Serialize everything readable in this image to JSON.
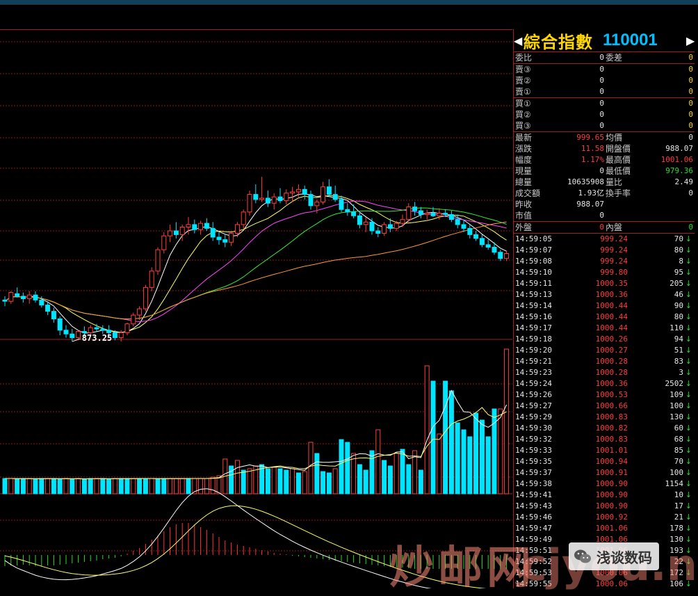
{
  "header": {
    "name": "綜合指數",
    "code": "110001"
  },
  "orders": {
    "top": [
      {
        "l1": "委比",
        "v1": "0",
        "l2": "委差",
        "v2": "0"
      }
    ],
    "sell": [
      {
        "label": "賣③",
        "price": "0",
        "vol": "0"
      },
      {
        "label": "賣②",
        "price": "0",
        "vol": "0"
      },
      {
        "label": "賣①",
        "price": "0",
        "vol": "0"
      }
    ],
    "buy": [
      {
        "label": "買①",
        "price": "0",
        "vol": "0"
      },
      {
        "label": "買②",
        "price": "0",
        "vol": "0"
      },
      {
        "label": "買③",
        "price": "0",
        "vol": "0"
      }
    ]
  },
  "stats": [
    {
      "l1": "最新",
      "v1": "999.65",
      "c1": "red",
      "l2": "均價",
      "v2": "0",
      "c2": "white"
    },
    {
      "l1": "漲跌",
      "v1": "11.58",
      "c1": "red",
      "l2": "開盤價",
      "v2": "988.07",
      "c2": "white"
    },
    {
      "l1": "幅度",
      "v1": "1.17%",
      "c1": "red",
      "l2": "最高價",
      "v2": "1001.06",
      "c2": "red"
    },
    {
      "l1": "現量",
      "v1": "0",
      "c1": "white",
      "l2": "最低價",
      "v2": "979.36",
      "c2": "green"
    },
    {
      "l1": "總量",
      "v1": "10635908",
      "c1": "white",
      "l2": "量比",
      "v2": "2.49",
      "c2": "white"
    },
    {
      "l1": "成交額",
      "v1": "1.93亿",
      "c1": "white",
      "l2": "換手率",
      "v2": "0",
      "c2": "white"
    },
    {
      "l1": "昨收",
      "v1": "988.07",
      "c1": "white",
      "l2": "",
      "v2": "",
      "c2": "white"
    },
    {
      "l1": "市值",
      "v1": "0",
      "c1": "white",
      "l2": "",
      "v2": "",
      "c2": "white"
    }
  ],
  "outer_inner": {
    "l1": "外盤",
    "v1": "0",
    "l2": "內盤",
    "v2": "0"
  },
  "trades": [
    {
      "time": "14:59:05",
      "price": "999.24",
      "vol": "70"
    },
    {
      "time": "14:59:07",
      "price": "999.24",
      "vol": "80"
    },
    {
      "time": "14:59:08",
      "price": "999.24",
      "vol": "8"
    },
    {
      "time": "14:59:10",
      "price": "999.80",
      "vol": "95"
    },
    {
      "time": "14:59:11",
      "price": "1000.35",
      "vol": "205"
    },
    {
      "time": "14:59:13",
      "price": "1000.36",
      "vol": "46"
    },
    {
      "time": "14:59:14",
      "price": "1000.44",
      "vol": "90"
    },
    {
      "time": "14:59:16",
      "price": "1000.44",
      "vol": "80"
    },
    {
      "time": "14:59:17",
      "price": "1000.44",
      "vol": "110"
    },
    {
      "time": "14:59:18",
      "price": "1000.26",
      "vol": "94"
    },
    {
      "time": "14:59:20",
      "price": "1000.27",
      "vol": "51"
    },
    {
      "time": "14:59:21",
      "price": "1000.28",
      "vol": "83"
    },
    {
      "time": "14:59:23",
      "price": "1000.28",
      "vol": "3"
    },
    {
      "time": "14:59:24",
      "price": "1000.36",
      "vol": "2502"
    },
    {
      "time": "14:59:26",
      "price": "1000.53",
      "vol": "109"
    },
    {
      "time": "14:59:27",
      "price": "1000.66",
      "vol": "100"
    },
    {
      "time": "14:59:29",
      "price": "1000.83",
      "vol": "130"
    },
    {
      "time": "14:59:30",
      "price": "1000.82",
      "vol": "60"
    },
    {
      "time": "14:59:32",
      "price": "1000.83",
      "vol": "68"
    },
    {
      "time": "14:59:33",
      "price": "1001.01",
      "vol": "85"
    },
    {
      "time": "14:59:35",
      "price": "1000.94",
      "vol": "70"
    },
    {
      "time": "14:59:37",
      "price": "1000.91",
      "vol": "100"
    },
    {
      "time": "14:59:38",
      "price": "1000.90",
      "vol": "1154"
    },
    {
      "time": "14:59:41",
      "price": "1000.90",
      "vol": "10"
    },
    {
      "time": "14:59:43",
      "price": "1000.90",
      "vol": "17"
    },
    {
      "time": "14:59:46",
      "price": "1000.92",
      "vol": "21"
    },
    {
      "time": "14:59:47",
      "price": "1001.06",
      "vol": "178"
    },
    {
      "time": "14:59:49",
      "price": "1001.06",
      "vol": "130"
    },
    {
      "time": "14:59:51",
      "price": "1001.06",
      "vol": "193"
    },
    {
      "time": "14:59:52",
      "price": "1001.06",
      "vol": "22"
    },
    {
      "time": "14:59:53",
      "price": "1000.06",
      "vol": "172"
    },
    {
      "time": "14:59:55",
      "price": "1000.06",
      "vol": "106"
    }
  ],
  "watermark": {
    "text": "炒邮网",
    "domain": "cjyou.net",
    "badge": "浅谈数码"
  },
  "colors": {
    "up": "#ff4040",
    "down": "#00e5ff",
    "grid": "#8b1a1a",
    "ma5": "#ffffff",
    "ma10": "#ffff66",
    "ma20": "#ff44ff",
    "ma30": "#33ee33",
    "ma60": "#ff9933"
  },
  "chart_data": {
    "type": "candlestick",
    "min_label": "873.25",
    "ohlc": [
      [
        898,
        901,
        893,
        897
      ],
      [
        897,
        905,
        895,
        904
      ],
      [
        903,
        908,
        900,
        901
      ],
      [
        901,
        904,
        896,
        899
      ],
      [
        899,
        905,
        895,
        902
      ],
      [
        902,
        905,
        896,
        898
      ],
      [
        898,
        901,
        892,
        894
      ],
      [
        894,
        897,
        886,
        889
      ],
      [
        889,
        892,
        880,
        883
      ],
      [
        883,
        885,
        870,
        874
      ],
      [
        874,
        878,
        868,
        871
      ],
      [
        871,
        875,
        865,
        868
      ],
      [
        868,
        874,
        866,
        873
      ],
      [
        873,
        877,
        869,
        872
      ],
      [
        872,
        878,
        870,
        876
      ],
      [
        876,
        879,
        873,
        875
      ],
      [
        875,
        878,
        871,
        874
      ],
      [
        874,
        878,
        870,
        872
      ],
      [
        872,
        874,
        866,
        868
      ],
      [
        868,
        874,
        865,
        872
      ],
      [
        872,
        880,
        870,
        879
      ],
      [
        879,
        888,
        877,
        886
      ],
      [
        886,
        893,
        882,
        891
      ],
      [
        891,
        910,
        889,
        908
      ],
      [
        908,
        924,
        905,
        921
      ],
      [
        921,
        940,
        918,
        938
      ],
      [
        938,
        952,
        935,
        949
      ],
      [
        949,
        958,
        944,
        953
      ],
      [
        953,
        960,
        947,
        950
      ],
      [
        950,
        958,
        945,
        956
      ],
      [
        956,
        964,
        950,
        958
      ],
      [
        958,
        962,
        951,
        954
      ],
      [
        954,
        961,
        950,
        959
      ],
      [
        959,
        963,
        953,
        955
      ],
      [
        955,
        960,
        945,
        948
      ],
      [
        948,
        952,
        942,
        946
      ],
      [
        946,
        950,
        940,
        944
      ],
      [
        944,
        953,
        941,
        951
      ],
      [
        951,
        960,
        948,
        958
      ],
      [
        958,
        970,
        954,
        968
      ],
      [
        968,
        985,
        965,
        982
      ],
      [
        982,
        990,
        975,
        978
      ],
      [
        978,
        996,
        976,
        979
      ],
      [
        979,
        985,
        972,
        975
      ],
      [
        975,
        983,
        970,
        980
      ],
      [
        980,
        987,
        975,
        977
      ],
      [
        977,
        986,
        974,
        983
      ],
      [
        983,
        988,
        976,
        984
      ],
      [
        984,
        990,
        980,
        986
      ],
      [
        986,
        989,
        978,
        982
      ],
      [
        982,
        985,
        970,
        973
      ],
      [
        973,
        978,
        967,
        976
      ],
      [
        976,
        992,
        974,
        988
      ],
      [
        988,
        994,
        980,
        982
      ],
      [
        982,
        989,
        976,
        978
      ],
      [
        978,
        981,
        968,
        970
      ],
      [
        970,
        975,
        965,
        968
      ],
      [
        968,
        974,
        963,
        965
      ],
      [
        965,
        968,
        955,
        958
      ],
      [
        958,
        964,
        952,
        960
      ],
      [
        960,
        963,
        950,
        953
      ],
      [
        953,
        956,
        948,
        951
      ],
      [
        951,
        960,
        949,
        958
      ],
      [
        958,
        963,
        952,
        955
      ],
      [
        955,
        961,
        953,
        959
      ],
      [
        959,
        966,
        956,
        962
      ],
      [
        962,
        975,
        960,
        972
      ],
      [
        972,
        976,
        965,
        969
      ],
      [
        969,
        972,
        963,
        966
      ],
      [
        966,
        970,
        962,
        967
      ],
      [
        967,
        972,
        964,
        965
      ],
      [
        965,
        971,
        962,
        967
      ],
      [
        967,
        970,
        964,
        966
      ],
      [
        966,
        969,
        960,
        962
      ],
      [
        962,
        966,
        955,
        958
      ],
      [
        958,
        962,
        952,
        955
      ],
      [
        955,
        958,
        947,
        950
      ],
      [
        950,
        953,
        945,
        947
      ],
      [
        947,
        950,
        940,
        942
      ],
      [
        942,
        946,
        938,
        940
      ],
      [
        940,
        944,
        934,
        936
      ],
      [
        936,
        938,
        929,
        931
      ],
      [
        931,
        937,
        929,
        935
      ]
    ],
    "volume": [
      [
        22,
        "down"
      ],
      [
        22,
        "up"
      ],
      [
        21,
        "down"
      ],
      [
        22,
        "down"
      ],
      [
        22,
        "up"
      ],
      [
        21,
        "down"
      ],
      [
        22,
        "down"
      ],
      [
        22,
        "up"
      ],
      [
        22,
        "down"
      ],
      [
        21,
        "down"
      ],
      [
        22,
        "up"
      ],
      [
        21,
        "down"
      ],
      [
        22,
        "up"
      ],
      [
        21,
        "down"
      ],
      [
        22,
        "down"
      ],
      [
        22,
        "up"
      ],
      [
        22,
        "down"
      ],
      [
        21,
        "down"
      ],
      [
        22,
        "up"
      ],
      [
        22,
        "down"
      ],
      [
        22,
        "down"
      ],
      [
        22,
        "up"
      ],
      [
        22,
        "down"
      ],
      [
        22,
        "down"
      ],
      [
        22,
        "up"
      ],
      [
        21,
        "down"
      ],
      [
        22,
        "down"
      ],
      [
        22,
        "up"
      ],
      [
        22,
        "up"
      ],
      [
        22,
        "up"
      ],
      [
        22,
        "down"
      ],
      [
        22,
        "up"
      ],
      [
        22,
        "up"
      ],
      [
        22,
        "up"
      ],
      [
        24,
        "up"
      ],
      [
        26,
        "up"
      ],
      [
        50,
        "up"
      ],
      [
        40,
        "down"
      ],
      [
        48,
        "up"
      ],
      [
        34,
        "down"
      ],
      [
        36,
        "up"
      ],
      [
        40,
        "up"
      ],
      [
        42,
        "down"
      ],
      [
        36,
        "down"
      ],
      [
        38,
        "up"
      ],
      [
        36,
        "down"
      ],
      [
        34,
        "down"
      ],
      [
        36,
        "up"
      ],
      [
        30,
        "down"
      ],
      [
        32,
        "up"
      ],
      [
        74,
        "up"
      ],
      [
        58,
        "down"
      ],
      [
        32,
        "down"
      ],
      [
        30,
        "down"
      ],
      [
        36,
        "up"
      ],
      [
        78,
        "down"
      ],
      [
        74,
        "down"
      ],
      [
        58,
        "up"
      ],
      [
        42,
        "down"
      ],
      [
        34,
        "down"
      ],
      [
        62,
        "down"
      ],
      [
        92,
        "up"
      ],
      [
        48,
        "down"
      ],
      [
        40,
        "down"
      ],
      [
        58,
        "up"
      ],
      [
        64,
        "down"
      ],
      [
        42,
        "down"
      ],
      [
        62,
        "up"
      ],
      [
        34,
        "down"
      ],
      [
        184,
        "up"
      ],
      [
        162,
        "down"
      ],
      [
        86,
        "up"
      ],
      [
        162,
        "down"
      ],
      [
        148,
        "down"
      ],
      [
        102,
        "down"
      ],
      [
        92,
        "down"
      ],
      [
        82,
        "down"
      ],
      [
        116,
        "down"
      ],
      [
        106,
        "down"
      ],
      [
        82,
        "down"
      ],
      [
        122,
        "down"
      ],
      [
        122,
        "up"
      ],
      [
        208,
        "up"
      ]
    ],
    "macd": [
      [
        -16,
        "down"
      ],
      [
        -15,
        "down"
      ],
      [
        -15,
        "down"
      ],
      [
        -14,
        "down"
      ],
      [
        -15,
        "down"
      ],
      [
        -16,
        "down"
      ],
      [
        -16,
        "down"
      ],
      [
        -15,
        "down"
      ],
      [
        -15,
        "down"
      ],
      [
        -14,
        "down"
      ],
      [
        -13,
        "down"
      ],
      [
        -12,
        "down"
      ],
      [
        -11,
        "down"
      ],
      [
        -10,
        "down"
      ],
      [
        -9,
        "down"
      ],
      [
        -8,
        "down"
      ],
      [
        -6,
        "down"
      ],
      [
        -5,
        "down"
      ],
      [
        -4,
        "down"
      ],
      [
        -2,
        "down"
      ],
      [
        2,
        "up"
      ],
      [
        6,
        "up"
      ],
      [
        10,
        "up"
      ],
      [
        16,
        "up"
      ],
      [
        22,
        "up"
      ],
      [
        28,
        "up"
      ],
      [
        34,
        "up"
      ],
      [
        40,
        "up"
      ],
      [
        44,
        "up"
      ],
      [
        46,
        "up"
      ],
      [
        46,
        "up"
      ],
      [
        44,
        "up"
      ],
      [
        40,
        "up"
      ],
      [
        36,
        "up"
      ],
      [
        31,
        "up"
      ],
      [
        26,
        "up"
      ],
      [
        21,
        "up"
      ],
      [
        18,
        "up"
      ],
      [
        15,
        "up"
      ],
      [
        13,
        "up"
      ],
      [
        11,
        "up"
      ],
      [
        9,
        "up"
      ],
      [
        7,
        "up"
      ],
      [
        5,
        "up"
      ],
      [
        3,
        "up"
      ],
      [
        2,
        "up"
      ],
      [
        1,
        "up"
      ],
      [
        -1,
        "down"
      ],
      [
        -2,
        "down"
      ],
      [
        -3,
        "down"
      ],
      [
        -4,
        "down"
      ],
      [
        -5,
        "down"
      ],
      [
        -6,
        "down"
      ],
      [
        -7,
        "down"
      ],
      [
        -8,
        "down"
      ],
      [
        -9,
        "down"
      ],
      [
        -10,
        "down"
      ],
      [
        -11,
        "down"
      ],
      [
        -12,
        "down"
      ],
      [
        -13,
        "down"
      ],
      [
        -14,
        "down"
      ],
      [
        -15,
        "down"
      ],
      [
        -16,
        "down"
      ],
      [
        -17,
        "down"
      ],
      [
        -18,
        "down"
      ],
      [
        -18,
        "down"
      ],
      [
        -19,
        "down"
      ],
      [
        -20,
        "down"
      ],
      [
        -20,
        "down"
      ],
      [
        -20,
        "down"
      ],
      [
        -20,
        "down"
      ],
      [
        -20,
        "down"
      ],
      [
        -20,
        "down"
      ],
      [
        -20,
        "down"
      ],
      [
        -20,
        "down"
      ],
      [
        -20,
        "down"
      ],
      [
        -20,
        "down"
      ],
      [
        -20,
        "down"
      ],
      [
        -20,
        "down"
      ],
      [
        -20,
        "down"
      ],
      [
        -20,
        "down"
      ],
      [
        -20,
        "down"
      ],
      [
        -20,
        "down"
      ]
    ]
  }
}
